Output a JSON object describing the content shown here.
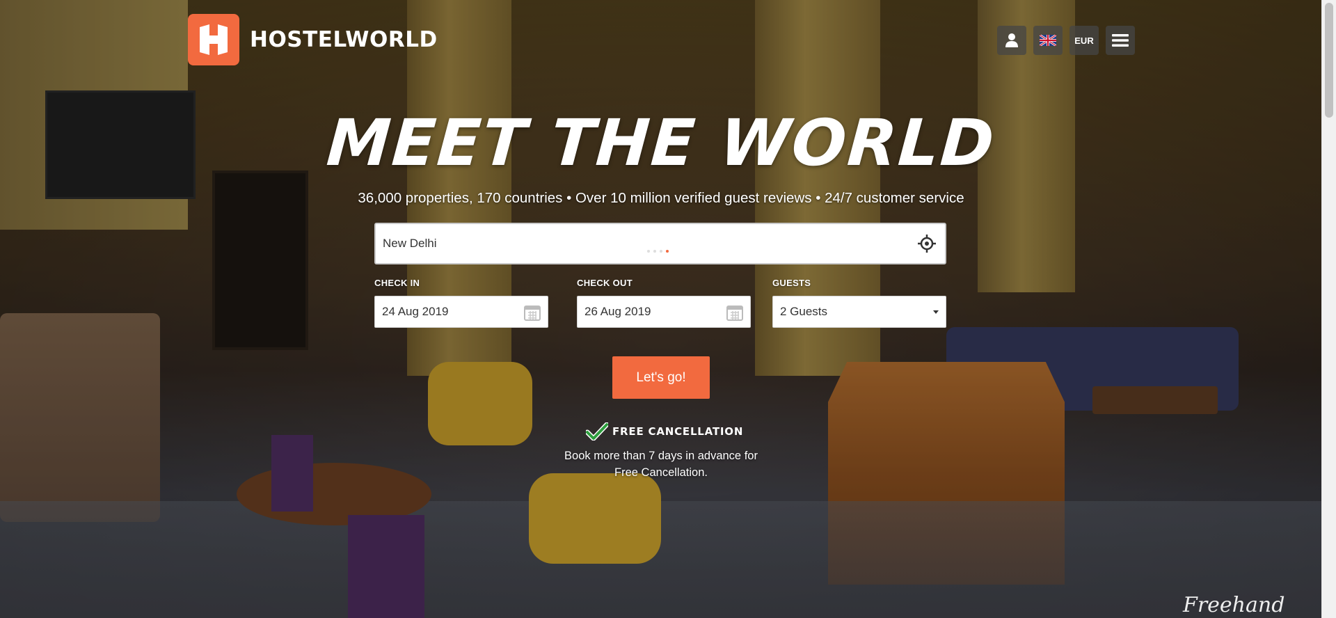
{
  "brand": {
    "name": "HOSTELWORLD",
    "accent_color": "#f26a3f"
  },
  "header": {
    "account_icon": "user-icon",
    "language_icon": "uk-flag-icon",
    "currency": "EUR",
    "menu_icon": "hamburger-menu-icon"
  },
  "hero": {
    "headline": "MEET THE WORLD",
    "subheadline": "36,000 properties, 170 countries • Over 10 million verified guest reviews • 24/7 customer service"
  },
  "search": {
    "destination_value": "New Delhi",
    "locate_icon": "crosshair-locate-icon"
  },
  "dates": {
    "checkin_label": "CHECK IN",
    "checkin_value": "24 Aug 2019",
    "checkout_label": "CHECK OUT",
    "checkout_value": "26 Aug 2019",
    "calendar_icon": "calendar-icon"
  },
  "guests": {
    "label": "GUESTS",
    "value": "2 Guests"
  },
  "cta": {
    "label": "Let's go!"
  },
  "cancellation": {
    "icon": "checkmark-icon",
    "title": "FREE CANCELLATION",
    "line1": "Book more than 7 days in advance for",
    "line2": "Free Cancellation."
  },
  "credit": {
    "signature": "Freehand"
  }
}
